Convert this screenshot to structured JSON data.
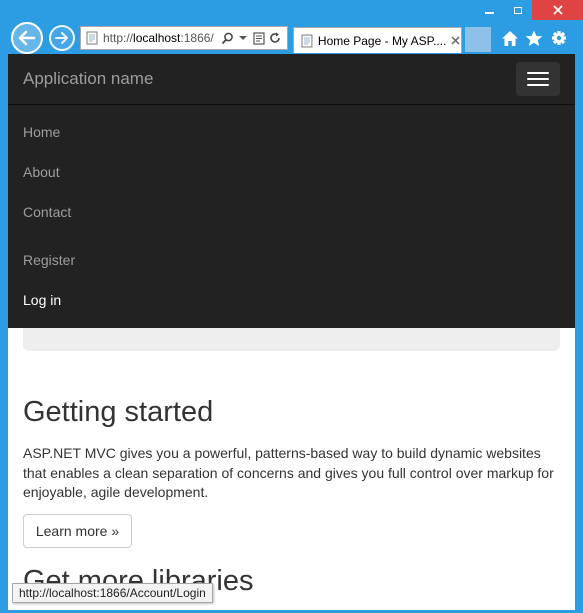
{
  "browser": {
    "address_url_prefix": "http://",
    "address_url_host": "localhost",
    "address_url_rest": ":1866/",
    "tab_title": "Home Page - My ASP....",
    "status_url": "http://localhost:1866/Account/Login"
  },
  "navbar": {
    "brand": "Application name",
    "links": [
      {
        "label": "Home"
      },
      {
        "label": "About"
      },
      {
        "label": "Contact"
      }
    ],
    "account_links": [
      {
        "label": "Register"
      },
      {
        "label": "Log in"
      }
    ]
  },
  "content": {
    "getting_started": {
      "heading": "Getting started",
      "text": "ASP.NET MVC gives you a powerful, patterns-based way to build dynamic websites that enables a clean separation of concerns and gives you full control over markup for enjoyable, agile development.",
      "button": "Learn more »"
    },
    "get_more_libraries": {
      "heading": "Get more libraries"
    }
  },
  "icons": {
    "back": "back-arrow-icon",
    "forward": "forward-arrow-icon",
    "page": "page-icon",
    "search": "search-icon",
    "dropdown": "chevron-down-icon",
    "compat": "compatibility-view-icon",
    "refresh": "refresh-icon",
    "tab_close": "close-icon",
    "home": "home-icon",
    "favorites": "star-icon",
    "settings": "gear-icon",
    "menu": "hamburger-icon"
  },
  "colors": {
    "frame": "#2d9de3",
    "close_button": "#e04343",
    "navbar": "#222222",
    "nav_link": "#9d9d9d",
    "nav_link_active": "#ffffff",
    "jumbotron": "#eeeeee",
    "text": "#333333"
  }
}
